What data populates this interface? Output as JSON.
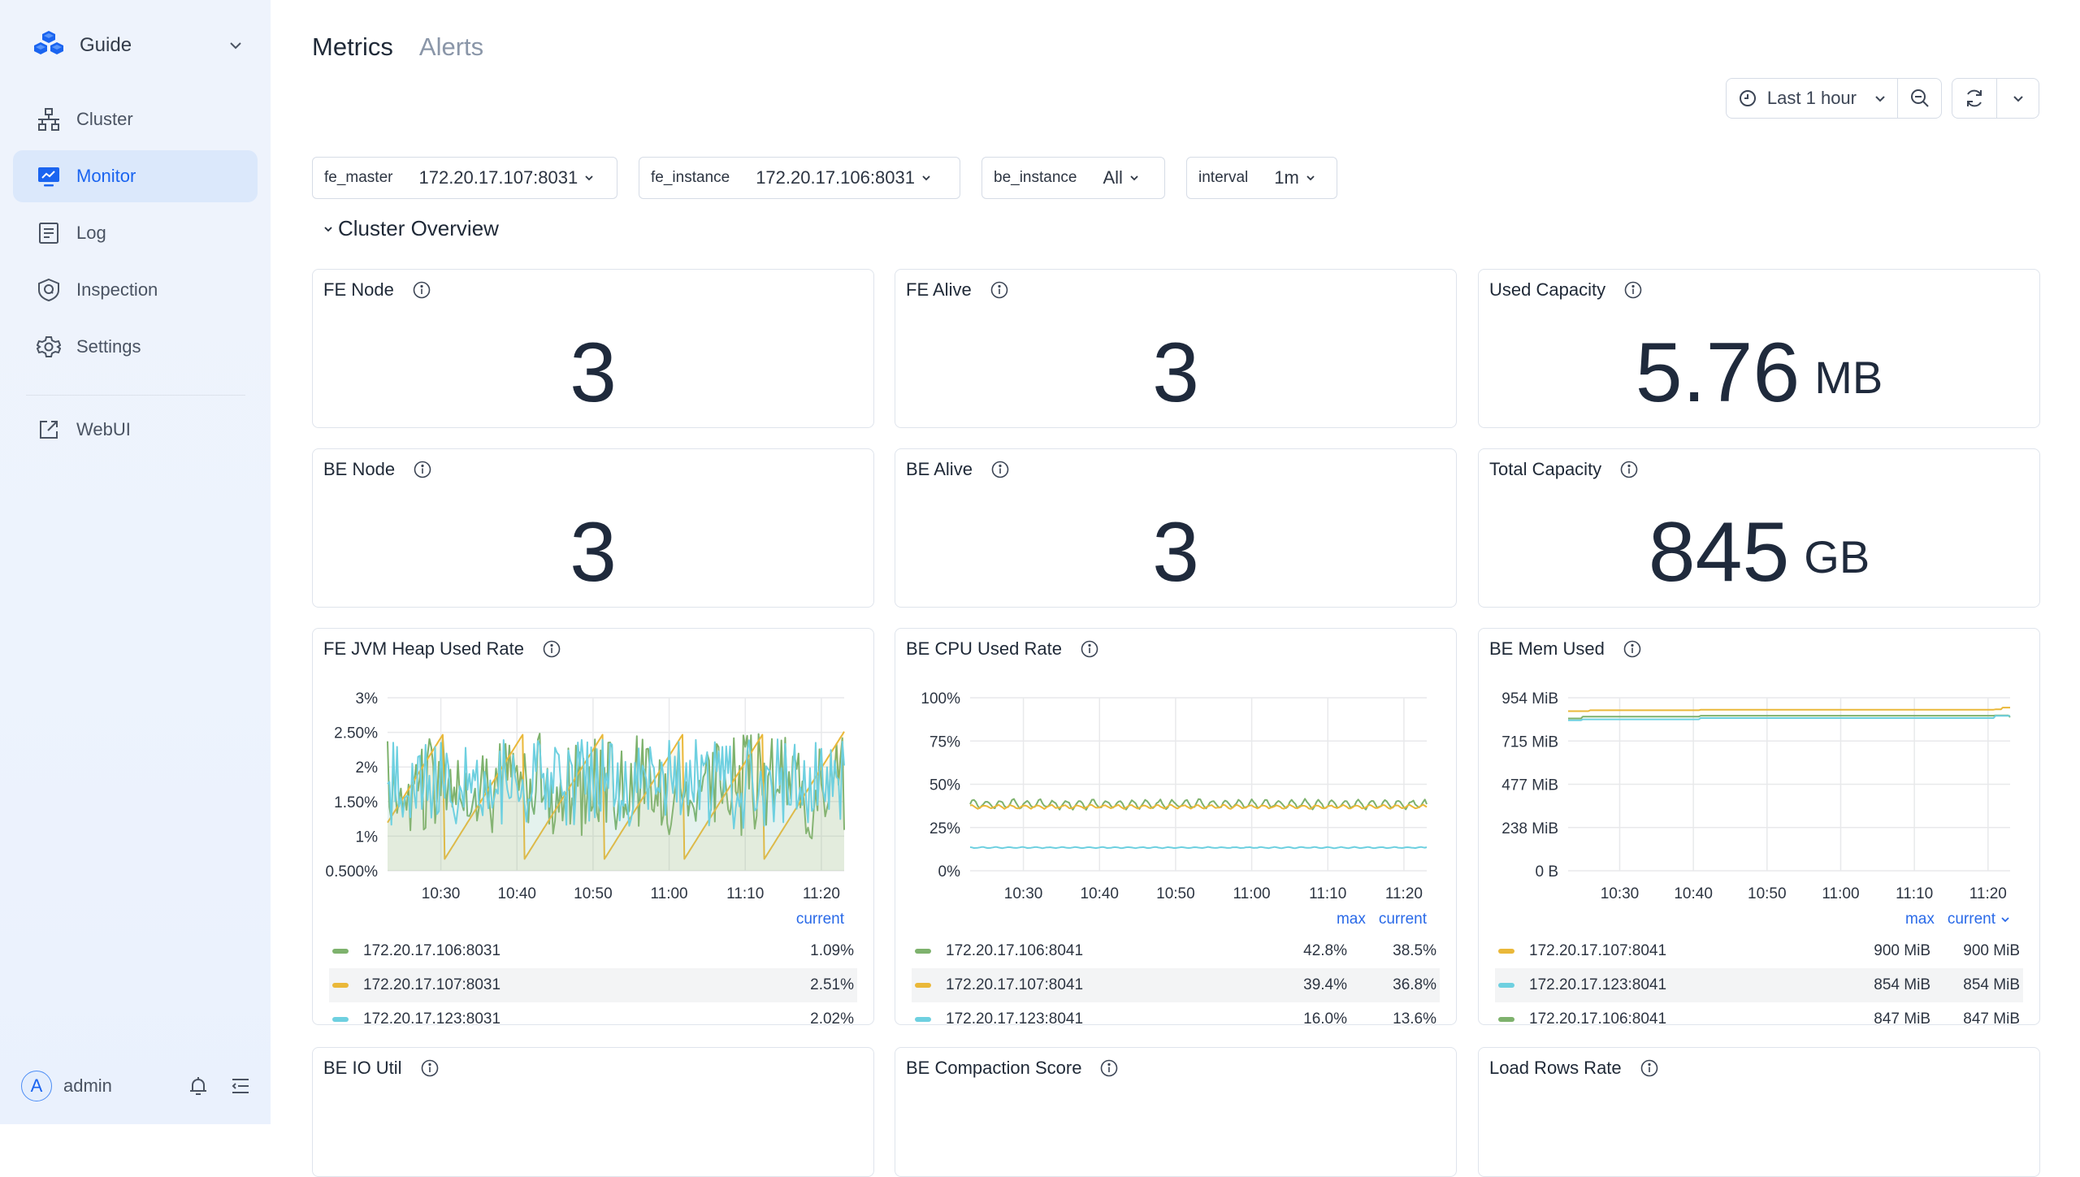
{
  "sidebar": {
    "brand": "Guide",
    "items": [
      {
        "label": "Cluster",
        "icon": "cluster-icon",
        "active": false
      },
      {
        "label": "Monitor",
        "icon": "monitor-icon",
        "active": true
      },
      {
        "label": "Log",
        "icon": "log-icon",
        "active": false
      },
      {
        "label": "Inspection",
        "icon": "inspection-icon",
        "active": false
      },
      {
        "label": "Settings",
        "icon": "gear-icon",
        "active": false
      }
    ],
    "external": {
      "label": "WebUI",
      "icon": "external-link-icon"
    },
    "user": {
      "initial": "A",
      "name": "admin"
    }
  },
  "tabs": [
    {
      "label": "Metrics",
      "active": true
    },
    {
      "label": "Alerts",
      "active": false
    }
  ],
  "toolbar": {
    "time_range": "Last 1 hour"
  },
  "filters": [
    {
      "key": "fe_master",
      "value": "172.20.17.107:8031"
    },
    {
      "key": "fe_instance",
      "value": "172.20.17.106:8031"
    },
    {
      "key": "be_instance",
      "value": "All"
    },
    {
      "key": "interval",
      "value": "1m"
    }
  ],
  "section": {
    "title": "Cluster Overview"
  },
  "stats": [
    {
      "title": "FE Node",
      "value": "3",
      "unit": ""
    },
    {
      "title": "FE Alive",
      "value": "3",
      "unit": ""
    },
    {
      "title": "Used Capacity",
      "value": "5.76",
      "unit": "MB"
    },
    {
      "title": "BE Node",
      "value": "3",
      "unit": ""
    },
    {
      "title": "BE Alive",
      "value": "3",
      "unit": ""
    },
    {
      "title": "Total Capacity",
      "value": "845",
      "unit": "GB"
    }
  ],
  "colors": {
    "green": "#7eb26d",
    "yellow": "#eab839",
    "cyan": "#6ed0e0",
    "accent": "#1a64f0"
  },
  "panels": [
    {
      "title": "FE JVM Heap Used Rate",
      "legend_columns": [
        "current"
      ],
      "legend": [
        {
          "name": "172.20.17.106:8031",
          "color": "#7eb26d",
          "values": [
            "1.09%"
          ]
        },
        {
          "name": "172.20.17.107:8031",
          "color": "#eab839",
          "values": [
            "2.51%"
          ]
        },
        {
          "name": "172.20.17.123:8031",
          "color": "#6ed0e0",
          "values": [
            "2.02%"
          ]
        }
      ]
    },
    {
      "title": "BE CPU Used Rate",
      "legend_columns": [
        "max",
        "current"
      ],
      "legend": [
        {
          "name": "172.20.17.106:8041",
          "color": "#7eb26d",
          "values": [
            "42.8%",
            "38.5%"
          ]
        },
        {
          "name": "172.20.17.107:8041",
          "color": "#eab839",
          "values": [
            "39.4%",
            "36.8%"
          ]
        },
        {
          "name": "172.20.17.123:8041",
          "color": "#6ed0e0",
          "values": [
            "16.0%",
            "13.6%"
          ]
        }
      ]
    },
    {
      "title": "BE Mem Used",
      "legend_columns": [
        "max",
        "current"
      ],
      "legend": [
        {
          "name": "172.20.17.107:8041",
          "color": "#eab839",
          "values": [
            "900 MiB",
            "900 MiB"
          ]
        },
        {
          "name": "172.20.17.123:8041",
          "color": "#6ed0e0",
          "values": [
            "854 MiB",
            "854 MiB"
          ]
        },
        {
          "name": "172.20.17.106:8041",
          "color": "#7eb26d",
          "values": [
            "847 MiB",
            "847 MiB"
          ]
        }
      ]
    }
  ],
  "bottom_panels": [
    {
      "title": "BE IO Util"
    },
    {
      "title": "BE Compaction Score"
    },
    {
      "title": "Load Rows Rate"
    }
  ],
  "chart_data": [
    {
      "type": "line",
      "title": "FE JVM Heap Used Rate",
      "x": [
        "10:30",
        "10:40",
        "10:50",
        "11:00",
        "11:10",
        "11:20"
      ],
      "xrange": [
        "10:23",
        "11:23"
      ],
      "ytick_labels": [
        "0.500%",
        "1%",
        "1.50%",
        "2%",
        "2.50%",
        "3%"
      ],
      "ylim": [
        0.5,
        3
      ],
      "grid": true,
      "fill": true,
      "series": [
        {
          "name": "172.20.17.106:8031",
          "color": "#7eb26d",
          "pattern": "noise",
          "min": 0.95,
          "max": 2.5,
          "current": 1.09
        },
        {
          "name": "172.20.17.107:8031",
          "color": "#eab839",
          "pattern": "sawtooth",
          "min": 0.67,
          "max": 2.51,
          "period_min": 10.5,
          "current": 2.51
        },
        {
          "name": "172.20.17.123:8031",
          "color": "#6ed0e0",
          "pattern": "noise",
          "min": 1.05,
          "max": 2.4,
          "current": 2.02
        }
      ]
    },
    {
      "type": "line",
      "title": "BE CPU Used Rate",
      "x": [
        "10:30",
        "10:40",
        "10:50",
        "11:00",
        "11:10",
        "11:20"
      ],
      "xrange": [
        "10:23",
        "11:23"
      ],
      "ytick_labels": [
        "0%",
        "25%",
        "50%",
        "75%",
        "100%"
      ],
      "ylim": [
        0,
        100
      ],
      "grid": true,
      "series": [
        {
          "name": "172.20.17.106:8041",
          "color": "#7eb26d",
          "base": 38.5,
          "amp": 2.5,
          "max": 42.8,
          "current": 38.5
        },
        {
          "name": "172.20.17.107:8041",
          "color": "#eab839",
          "base": 37,
          "amp": 1,
          "max": 39.4,
          "current": 36.8
        },
        {
          "name": "172.20.17.123:8041",
          "color": "#6ed0e0",
          "base": 13.4,
          "amp": 0.3,
          "max": 16.0,
          "current": 13.6
        }
      ]
    },
    {
      "type": "line",
      "title": "BE Mem Used",
      "x": [
        "10:30",
        "10:40",
        "10:50",
        "11:00",
        "11:10",
        "11:20"
      ],
      "xrange": [
        "10:23",
        "11:23"
      ],
      "ytick_labels": [
        "0 B",
        "238 MiB",
        "477 MiB",
        "715 MiB",
        "954 MiB"
      ],
      "ylim": [
        0,
        954
      ],
      "grid": true,
      "series": [
        {
          "name": "172.20.17.107:8041",
          "color": "#eab839",
          "steps": [
            [
              0,
              880
            ],
            [
              3,
              885
            ],
            [
              18,
              888
            ],
            [
              58,
              890
            ],
            [
              59,
              900
            ]
          ],
          "current": 900
        },
        {
          "name": "172.20.17.106:8041",
          "color": "#7eb26d",
          "steps": [
            [
              0,
              840
            ],
            [
              2,
              850
            ],
            [
              18,
              855
            ],
            [
              58,
              857
            ]
          ],
          "current": 847
        },
        {
          "name": "172.20.17.123:8041",
          "color": "#6ed0e0",
          "steps": [
            [
              0,
              830
            ],
            [
              2,
              835
            ],
            [
              18,
              842
            ],
            [
              58,
              854
            ]
          ],
          "current": 854
        }
      ]
    }
  ]
}
